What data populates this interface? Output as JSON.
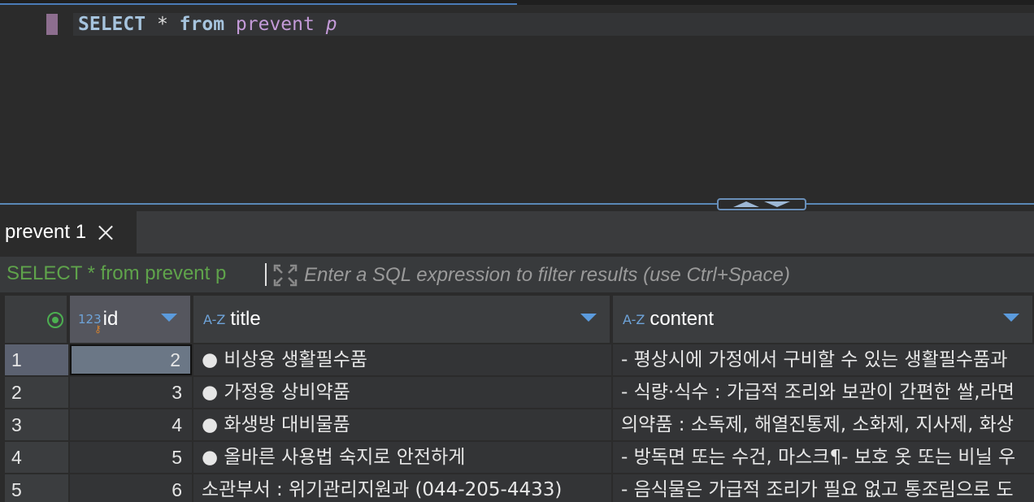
{
  "editor": {
    "query_keyword_select": "SELECT",
    "query_star": "*",
    "query_keyword_from": "from",
    "query_table": "prevent",
    "query_alias": "p"
  },
  "results_tab": {
    "label": "prevent 1"
  },
  "filter": {
    "active_query": "SELECT * from prevent p",
    "placeholder": "Enter a SQL expression to filter results (use Ctrl+Space)"
  },
  "grid": {
    "columns": [
      {
        "name": "id",
        "type_icon": "123"
      },
      {
        "name": "title",
        "type_icon": "A-Z"
      },
      {
        "name": "content",
        "type_icon": "A-Z"
      }
    ],
    "rows": [
      {
        "num": "1",
        "id": "2",
        "title": "● 비상용 생활필수품",
        "content": "- 평상시에 가정에서 구비할 수 있는 생활필수품과"
      },
      {
        "num": "2",
        "id": "3",
        "title": "● 가정용 상비약품",
        "content": "- 식량·식수 : 가급적 조리와 보관이 간편한 쌀,라면"
      },
      {
        "num": "3",
        "id": "4",
        "title": "● 화생방 대비물품",
        "content": "의약품 : 소독제, 해열진통제, 소화제, 지사제, 화상"
      },
      {
        "num": "4",
        "id": "5",
        "title": "● 올바른 사용법 숙지로 안전하게",
        "content": "- 방독면 또는 수건, 마스크¶- 보호 옷 또는 비닐 우"
      },
      {
        "num": "5",
        "id": "6",
        "title": "소관부서 : 위기관리지원과 (044-205-4433)",
        "content": "- 음식물은 가급적 조리가 필요 없고 통조림으로 도"
      }
    ]
  },
  "colors": {
    "background": "#2b2b2b",
    "keyword": "#a6c4de",
    "identifier": "#c39ad8",
    "filter_query": "#5fa34b",
    "accent": "#5b9bdd"
  }
}
